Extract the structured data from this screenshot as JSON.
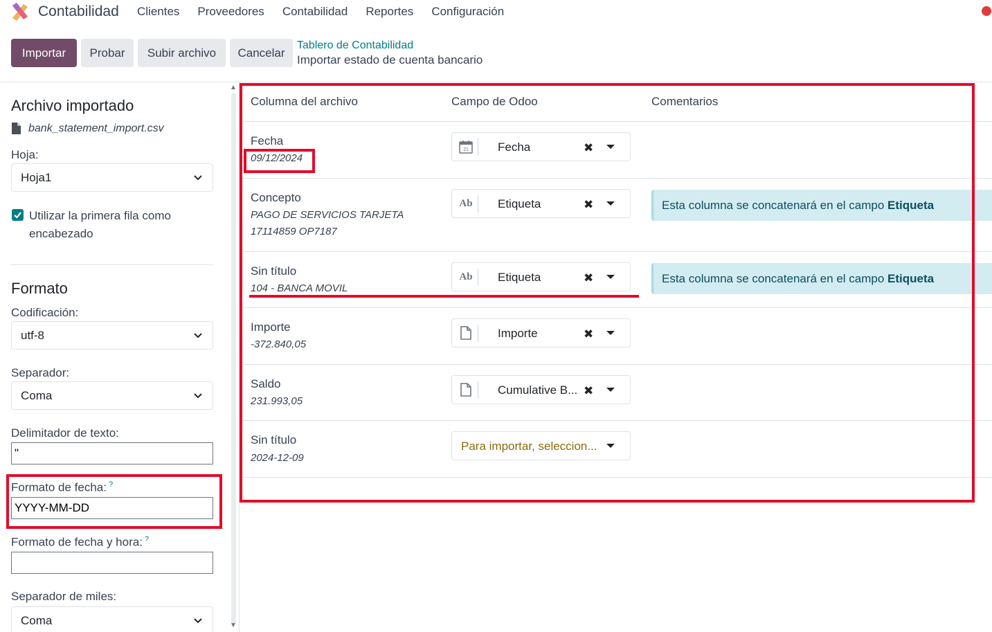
{
  "app": {
    "name": "Contabilidad"
  },
  "menu": [
    "Clientes",
    "Proveedores",
    "Contabilidad",
    "Reportes",
    "Configuración"
  ],
  "toolbar": {
    "import": "Importar",
    "test": "Probar",
    "upload": "Subir archivo",
    "cancel": "Cancelar"
  },
  "breadcrumb": {
    "parent": "Tablero de Contabilidad",
    "current": "Importar estado de cuenta bancario"
  },
  "sidebar": {
    "imported_title": "Archivo importado",
    "file_name": "bank_statement_import.csv",
    "sheet_label": "Hoja:",
    "sheet_value": "Hoja1",
    "header_checkbox_label": "Utilizar la primera fila como encabezado",
    "header_checkbox_checked": true,
    "format_title": "Formato",
    "encoding_label": "Codificación:",
    "encoding_value": "utf-8",
    "separator_label": "Separador:",
    "separator_value": "Coma",
    "text_delim_label": "Delimitador de texto:",
    "text_delim_value": "\"",
    "date_format_label": "Formato de fecha:",
    "date_format_value": "YYYY-MM-DD",
    "datetime_format_label": "Formato de fecha y hora:",
    "datetime_format_value": "",
    "thousands_label": "Separador de miles:",
    "thousands_value": "Coma",
    "help_mark": "?"
  },
  "table": {
    "headers": [
      "Columna del archivo",
      "Campo de Odoo",
      "Comentarios"
    ],
    "rows": [
      {
        "column": "Fecha",
        "sample": "09/12/2024",
        "field": "Fecha",
        "icon": "calendar-icon",
        "comment": ""
      },
      {
        "column": "Concepto",
        "sample_line1": "PAGO DE SERVICIOS TARJETA",
        "sample_line2": "17114859 OP7187",
        "field": "Etiqueta",
        "icon": "text-field-icon",
        "comment_prefix": "Esta columna se concatenará en el campo",
        "comment_field": "Etiqueta"
      },
      {
        "column": "Sin título",
        "sample": "104 - BANCA MOVIL",
        "field": "Etiqueta",
        "icon": "text-field-icon",
        "comment_prefix": "Esta columna se concatenará en el campo",
        "comment_field": "Etiqueta"
      },
      {
        "column": "Importe",
        "sample": "-372.840,05",
        "field": "Importe",
        "icon": "document-icon",
        "comment": ""
      },
      {
        "column": "Saldo",
        "sample": "231.993,05",
        "field": "Cumulative B...",
        "icon": "document-icon",
        "comment": ""
      },
      {
        "column": "Sin título",
        "sample": "2024-12-09",
        "field_placeholder": "Para importar, seleccion...",
        "comment": ""
      }
    ],
    "text_icon_label": "Ab",
    "clear_symbol": "✖"
  },
  "colors": {
    "primary": "#714b67",
    "link": "#017e84",
    "highlight": "#e30c2a",
    "comment_bg": "#d3ecf1"
  }
}
